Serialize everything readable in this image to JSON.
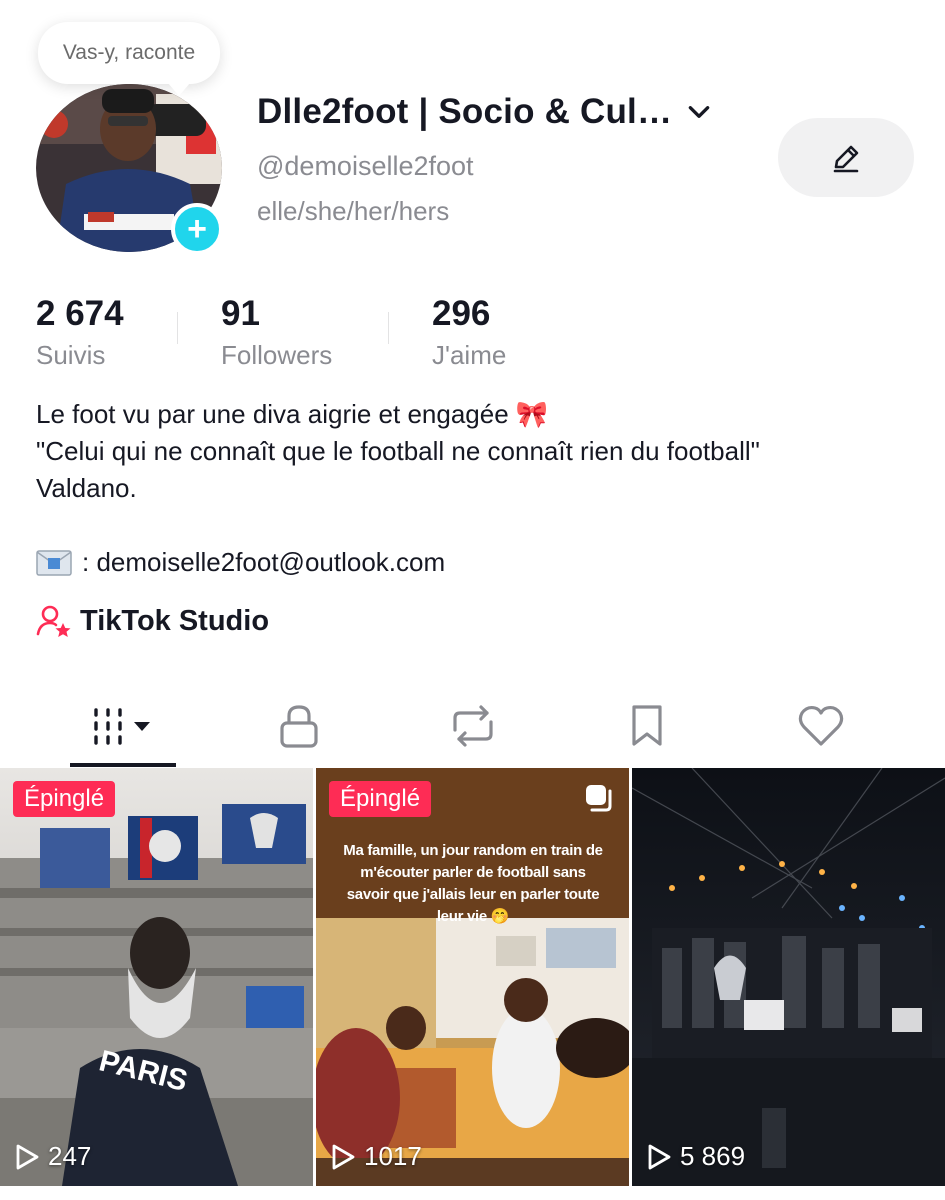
{
  "header": {
    "bubble_text": "Vas-y, raconte",
    "display_name": "Dlle2foot | Socio & Cul…",
    "username": "@demoiselle2foot",
    "pronouns": "elle/she/her/hers"
  },
  "stats": [
    {
      "value": "2 674",
      "label": "Suivis"
    },
    {
      "value": "91",
      "label": "Followers"
    },
    {
      "value": "296",
      "label": "J'aime"
    }
  ],
  "bio": {
    "lines": [
      "Le foot vu par une diva aigrie et engagée 🎀",
      "\"Celui qui ne connaît que le football ne connaît rien du football\"",
      "Valdano."
    ],
    "email": ": demoiselle2foot@outlook.com"
  },
  "studio": {
    "label": "TikTok Studio"
  },
  "tabs": [
    {
      "name": "videos-grid",
      "icon": "grid-icon",
      "active": true
    },
    {
      "name": "private",
      "icon": "lock-icon"
    },
    {
      "name": "reposts",
      "icon": "repost-icon"
    },
    {
      "name": "favorites",
      "icon": "bookmark-icon"
    },
    {
      "name": "liked",
      "icon": "heart-icon"
    }
  ],
  "videos": [
    {
      "pinned_label": "Épinglé",
      "views": "247"
    },
    {
      "pinned_label": "Épinglé",
      "views": "1017",
      "overlay_text": "Ma famille, un jour random en train de m'écouter parler de football sans savoir que j'allais leur en parler toute leur vie 🤭"
    },
    {
      "views": "5 869"
    }
  ],
  "colors": {
    "accent": "#fe2c55",
    "add_button": "#20d5ec",
    "secondary_text": "#8a8b91",
    "primary_text": "#161823"
  }
}
